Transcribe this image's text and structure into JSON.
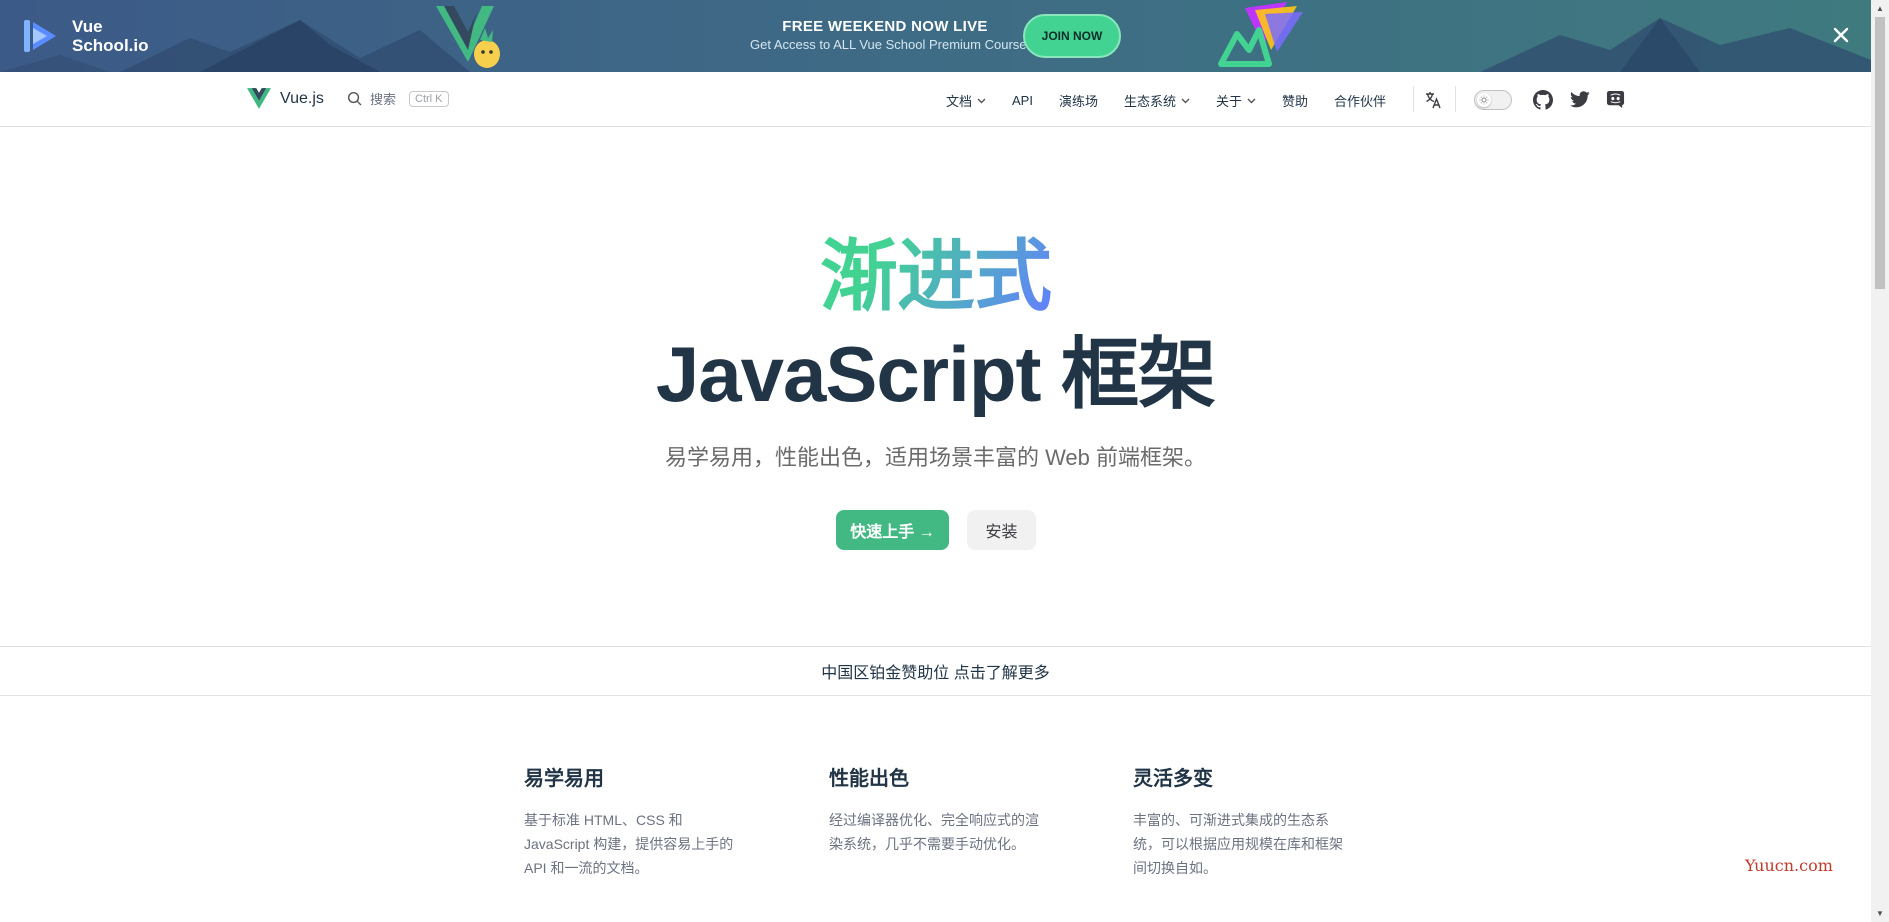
{
  "promo": {
    "brand_line1": "Vue",
    "brand_line2": "School.io",
    "title": "FREE WEEKEND NOW LIVE",
    "subtitle": "Get Access to ALL Vue School Premium Courses",
    "cta": "JOIN NOW",
    "close_icon": "close-icon"
  },
  "nav": {
    "brand": "Vue.js",
    "search_label": "搜索",
    "search_shortcut": "Ctrl K",
    "items": [
      {
        "label": "文档",
        "dropdown": true
      },
      {
        "label": "API",
        "dropdown": false
      },
      {
        "label": "演练场",
        "dropdown": false
      },
      {
        "label": "生态系统",
        "dropdown": true
      },
      {
        "label": "关于",
        "dropdown": true
      },
      {
        "label": "赞助",
        "dropdown": false
      },
      {
        "label": "合作伙伴",
        "dropdown": false
      }
    ],
    "icons": [
      "translate-icon",
      "theme-toggle",
      "github-icon",
      "twitter-icon",
      "discord-icon"
    ]
  },
  "hero": {
    "accent": "渐进式",
    "title": "JavaScript 框架",
    "tagline": "易学易用，性能出色，适用场景丰富的 Web 前端框架。",
    "primary_button": "快速上手 →",
    "secondary_button": "安装"
  },
  "sponsor": {
    "text": "中国区铂金赞助位 点击了解更多"
  },
  "features": [
    {
      "title": "易学易用",
      "description": "基于标准 HTML、CSS 和 JavaScript 构建，提供容易上手的 API 和一流的文档。"
    },
    {
      "title": "性能出色",
      "description": "经过编译器优化、完全响应式的渲染系统，几乎不需要手动优化。"
    },
    {
      "title": "灵活多变",
      "description": "丰富的、可渐进式集成的生态系统，可以根据应用规模在库和框架间切换自如。"
    }
  ],
  "watermark": "Yuucn.com",
  "colors": {
    "brand_green": "#42b883",
    "banner_bg": "#3e6a86",
    "join_green": "#42d392",
    "text_dark": "#213547"
  }
}
